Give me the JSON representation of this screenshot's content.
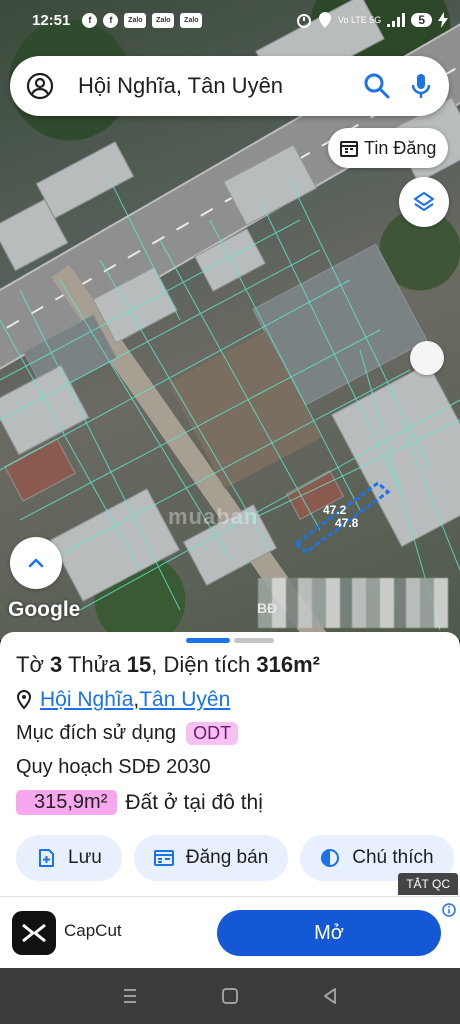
{
  "status_bar": {
    "time": "12:51",
    "apps": [
      "f",
      "f",
      "Zalo",
      "Zalo",
      "Zalo"
    ],
    "network": "Vo LTE 5G",
    "battery": "5"
  },
  "search": {
    "query": "Hội Nghĩa, Tân Uyên"
  },
  "map": {
    "tin_dang_label": "Tin Đăng",
    "measure_1": "47.2",
    "measure_2": "47.8",
    "watermark": "muaban",
    "blurred_label": "BĐ",
    "google_label": "Google"
  },
  "parcel": {
    "to_label": "Tờ",
    "to_value": "3",
    "thua_label": "Thửa",
    "thua_value": "15",
    "area_label": ", Diện tích",
    "area_value": "316m²",
    "location_part1": "Hội Nghĩa",
    "location_sep": ", ",
    "location_part2": "Tân Uyên",
    "purpose_label": "Mục đích sử dụng",
    "purpose_tag": "ODT",
    "plan_label": "Quy hoạch SDĐ 2030",
    "plan_area": "315,9m²",
    "plan_desc": "Đất ở tại đô thị"
  },
  "actions": {
    "save": "Lưu",
    "sell": "Đăng bán",
    "legend": "Chú thích"
  },
  "ad": {
    "close_label": "TẮT QC",
    "app_name": "CapCut",
    "open_label": "Mở"
  },
  "colors": {
    "accent": "#1a73e8",
    "chip_bg": "#e8f0fe",
    "odt_tag": "#f6c0f2",
    "area_tag": "#f6a7ee",
    "open_button": "#1558d6"
  }
}
